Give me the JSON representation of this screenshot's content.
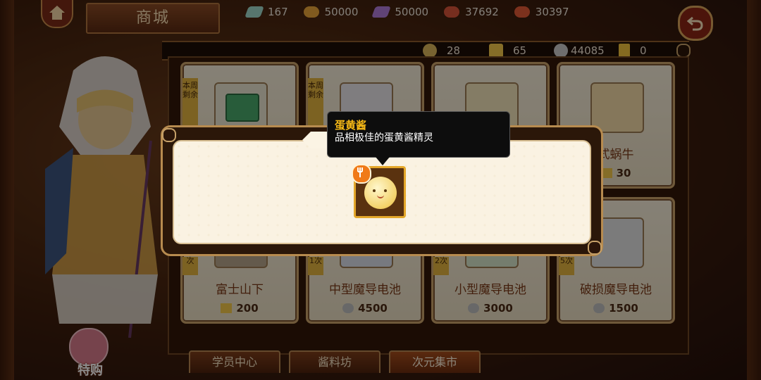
{
  "header": {
    "title": "商城",
    "currencies": [
      {
        "icon": "gem-icon",
        "value": "167",
        "color": "#9fd7c8"
      },
      {
        "icon": "potion-icon",
        "value": "50000",
        "color": "#e9a43a"
      },
      {
        "icon": "crystal-icon",
        "value": "50000",
        "color": "#b07ad8"
      },
      {
        "icon": "meat-icon",
        "value": "37692",
        "color": "#d8553a"
      },
      {
        "icon": "drink-icon",
        "value": "30397",
        "color": "#e25a35"
      }
    ]
  },
  "subbar": {
    "currencies": [
      {
        "icon": "coin-icon",
        "value": "28"
      },
      {
        "icon": "cheese-icon",
        "value": "65"
      },
      {
        "icon": "silver-coin-icon",
        "value": "44085"
      },
      {
        "icon": "ticket-icon",
        "value": "0"
      }
    ]
  },
  "shop": {
    "row1": [
      {
        "ribbon": "本周剩余",
        "name": ""
      },
      {
        "ribbon": "本周剩余",
        "name": ""
      },
      {
        "ribbon": "",
        "name": ""
      },
      {
        "ribbon": "",
        "name": "式蜗牛",
        "price": "30"
      }
    ],
    "row2": [
      {
        "ribbon": "次",
        "name": "富士山下",
        "price": "200"
      },
      {
        "ribbon": "1次",
        "name": "中型魔导电池",
        "price": "4500"
      },
      {
        "ribbon": "2次",
        "name": "小型魔导电池",
        "price": "3000"
      },
      {
        "ribbon": "5次",
        "name": "破损魔导电池",
        "price": "1500"
      }
    ]
  },
  "tooltip": {
    "title": "蛋黄酱",
    "description": "品相极佳的蛋黄酱精灵"
  },
  "tabs": [
    {
      "label": "学员中心",
      "active": false
    },
    {
      "label": "酱料坊",
      "active": false
    },
    {
      "label": "次元集市",
      "active": true
    }
  ],
  "merchant": {
    "label": "特购"
  }
}
